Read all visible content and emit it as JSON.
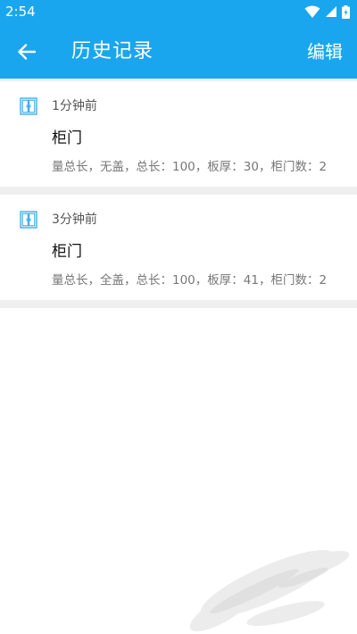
{
  "status_bar": {
    "time": "2:54",
    "icons": [
      "wifi-icon",
      "cell-signal-icon",
      "battery-charging-icon"
    ]
  },
  "app_bar": {
    "title": "历史记录",
    "edit_label": "编辑",
    "back_icon": "arrow-left-icon"
  },
  "records": [
    {
      "time": "1分钟前",
      "title": "柜门",
      "description": "量总长，无盖，总长：100，板厚：30，柜门数：2",
      "icon": "cabinet-door-icon"
    },
    {
      "time": "3分钟前",
      "title": "柜门",
      "description": "量总长，全盖，总长：100，板厚：41，柜门数：2",
      "icon": "cabinet-door-icon"
    }
  ],
  "colors": {
    "primary": "#1aa6ee",
    "background": "#ffffff",
    "separator": "#efefef",
    "title_text": "#111111",
    "secondary_text": "#777777",
    "icon_accent": "#3fb0e8"
  }
}
